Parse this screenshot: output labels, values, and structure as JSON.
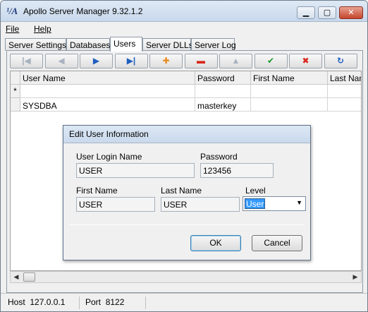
{
  "window": {
    "title": "Apollo Server Manager 9.32.1.2"
  },
  "menu": [
    {
      "label": "File"
    },
    {
      "label": "Help"
    }
  ],
  "tabs": [
    {
      "label": "Server Settings"
    },
    {
      "label": "Databases"
    },
    {
      "label": "Users",
      "active": true
    },
    {
      "label": "Server DLLs"
    },
    {
      "label": "Server Log"
    }
  ],
  "navigator": {
    "buttons": [
      {
        "name": "first-record",
        "icon": "|◀",
        "enabled": false
      },
      {
        "name": "prior-record",
        "icon": "◀",
        "enabled": false
      },
      {
        "name": "next-record",
        "icon": "▶",
        "enabled": true
      },
      {
        "name": "last-record",
        "icon": "▶|",
        "enabled": true
      },
      {
        "name": "insert-record",
        "icon": "✚",
        "enabled": true
      },
      {
        "name": "delete-record",
        "icon": "▬",
        "enabled": true
      },
      {
        "name": "edit-record",
        "icon": "▲",
        "enabled": false
      },
      {
        "name": "post-edit",
        "icon": "✔",
        "enabled": true
      },
      {
        "name": "cancel-edit",
        "icon": "✖",
        "enabled": true
      },
      {
        "name": "refresh-data",
        "icon": "↻",
        "enabled": true
      }
    ],
    "colors": {
      "blue": "#1f5fbf",
      "orange": "#e8891a",
      "red": "#d9261c",
      "green": "#1e9a2a",
      "disabled": "#a8b2c0"
    }
  },
  "grid": {
    "columns": [
      "User Name",
      "Password",
      "First Name",
      "Last Nam"
    ],
    "rows": [
      {
        "indicator": "*",
        "values": [
          "",
          "",
          "",
          ""
        ]
      },
      {
        "indicator": "",
        "values": [
          "SYSDBA",
          "masterkey",
          "",
          ""
        ]
      }
    ]
  },
  "status": {
    "host_label": "Host",
    "host_value": "127.0.0.1",
    "port_label": "Port",
    "port_value": "8122"
  },
  "dialog": {
    "title": "Edit User Information",
    "login_label": "User Login Name",
    "login_value": "USER",
    "password_label": "Password",
    "password_value": "123456",
    "first_label": "First Name",
    "first_value": "USER",
    "last_label": "Last Name",
    "last_value": "USER",
    "level_label": "Level",
    "level_value": "User",
    "ok_label": "OK",
    "cancel_label": "Cancel"
  }
}
